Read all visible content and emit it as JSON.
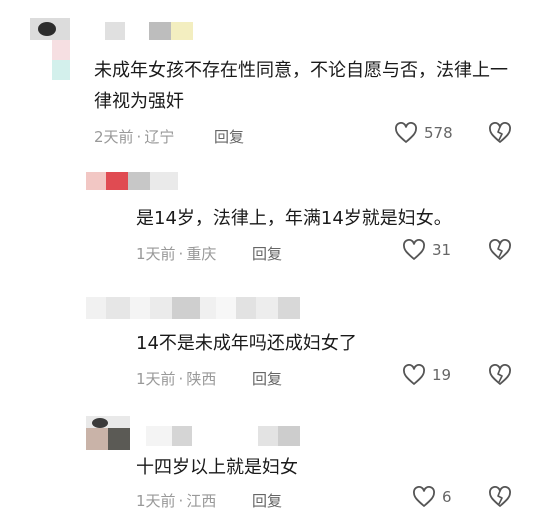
{
  "comments": [
    {
      "text": "未成年女孩不存在性同意，不论自愿与否，法律上一律视为强奸",
      "time": "2天前",
      "location": "辽宁",
      "separator": "·",
      "reply_label": "回复",
      "likes": "578"
    },
    {
      "text": "是14岁，法律上，年满14岁就是妇女。",
      "time": "1天前",
      "location": "重庆",
      "separator": "·",
      "reply_label": "回复",
      "likes": "31"
    },
    {
      "text": "14不是未成年吗还成妇女了",
      "time": "1天前",
      "location": "陕西",
      "separator": "·",
      "reply_label": "回复",
      "likes": "19"
    },
    {
      "text": "十四岁以上就是妇女",
      "time": "1天前",
      "location": "江西",
      "separator": "·",
      "reply_label": "回复",
      "likes": "6"
    }
  ],
  "icons": {
    "like": "heart-outline-icon",
    "dislike": "broken-heart-icon"
  },
  "colors": {
    "text": "#1a1a1a",
    "meta": "#999999",
    "icon": "#555555"
  }
}
